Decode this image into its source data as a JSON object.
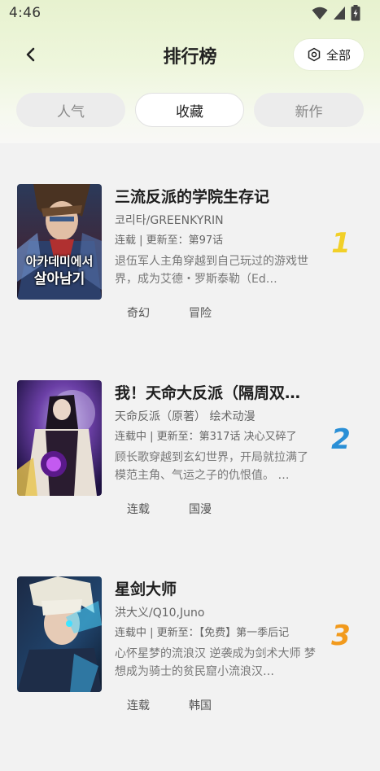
{
  "status_bar": {
    "time": "4:46"
  },
  "header": {
    "title": "排行榜",
    "filter_label": "全部"
  },
  "tabs": [
    {
      "label": "人气",
      "active": false
    },
    {
      "label": "收藏",
      "active": true
    },
    {
      "label": "新作",
      "active": false
    }
  ],
  "items": [
    {
      "title": "三流反派的学院生存记",
      "author": "코리타/GREENKYRIN",
      "update": "连载 | 更新至：第97话",
      "description": "退伍军人主角穿越到自己玩过的游戏世界，成为艾德・罗斯泰勒（Ed…",
      "tags": [
        "奇幻",
        "冒险"
      ],
      "rank": "1",
      "rank_color": "#f2d028",
      "cover_text_line1": "아카데미에서",
      "cover_text_line2": "살아남기"
    },
    {
      "title": "我！天命大反派（隔周双…",
      "author": "天命反派（原著） 绘术动漫",
      "update": "连载中 | 更新至：第317话 决心又碎了",
      "description": "顾长歌穿越到玄幻世界，开局就拉满了模范主角、气运之子的仇恨值。 …",
      "tags": [
        "连载",
        "国漫"
      ],
      "rank": "2",
      "rank_color": "#2a8fd6"
    },
    {
      "title": "星剑大师",
      "author": "洪大义/Q10,Juno",
      "update": "连载中 | 更新至：【免费】第一季后记",
      "description": "心怀星梦的流浪汉 逆袭成为剑术大师 梦想成为骑士的贫民窟小流浪汉…",
      "tags": [
        "连载",
        "韩国"
      ],
      "rank": "3",
      "rank_color": "#f29a1c"
    }
  ]
}
